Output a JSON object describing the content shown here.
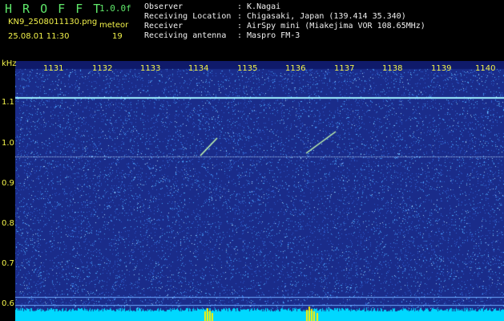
{
  "header": {
    "logo": "H R O F F T",
    "version": "1.0.0f",
    "filename": "KN9_2508011130.png",
    "mode": "meteor",
    "datetime": "25.08.01 11:30",
    "count": "19",
    "info": [
      {
        "key": "Observer",
        "value": ": K.Nagai"
      },
      {
        "key": "Receiving Location",
        "value": ": Chigasaki, Japan (139.414 35.340)"
      },
      {
        "key": "Receiver",
        "value": ": AirSpy mini (Miakejima VOR 108.65MHz)"
      },
      {
        "key": "Receiving antenna",
        "value": ": Maspro FM-3"
      }
    ]
  },
  "spectrogram": {
    "y_unit": "kHz",
    "y_ticks": [
      "1.1",
      "1.0",
      "0.9",
      "0.8",
      "0.7",
      "0.6"
    ],
    "x_ticks": [
      "1131",
      "1132",
      "1133",
      "1134",
      "1135",
      "1136",
      "1137",
      "1138",
      "1139",
      "1140"
    ],
    "colors": {
      "background": "#1a2c8a",
      "noise": "#4aa8ff",
      "carrier": "#9ff0ff",
      "meteor": "#c8ffb0",
      "bottom_bar": "#00d8ff",
      "bottom_peak": "#fff000"
    }
  }
}
